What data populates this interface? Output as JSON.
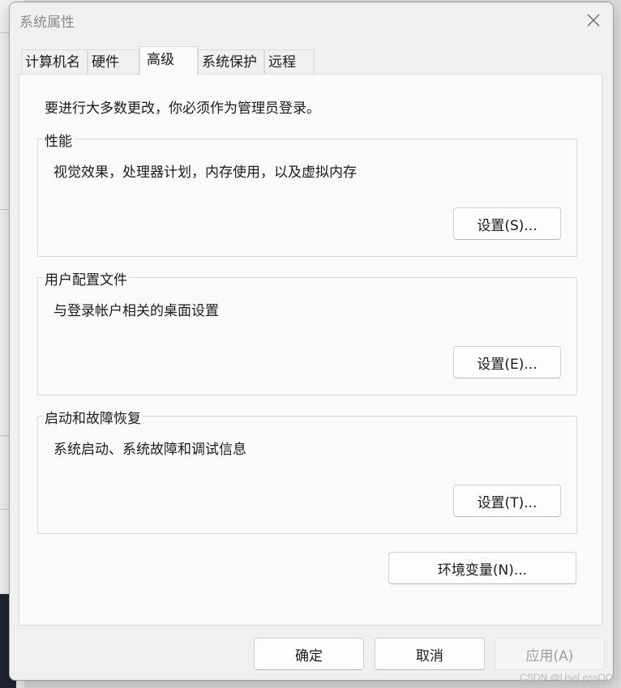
{
  "window": {
    "title": "系统属性"
  },
  "tabs": [
    {
      "label": "计算机名",
      "active": false
    },
    {
      "label": "硬件",
      "active": false
    },
    {
      "label": "高级",
      "active": true
    },
    {
      "label": "系统保护",
      "active": false
    },
    {
      "label": "远程",
      "active": false
    }
  ],
  "intro": "要进行大多数更改，你必须作为管理员登录。",
  "groups": [
    {
      "title": "性能",
      "description": "视觉效果，处理器计划，内存使用，以及虚拟内存",
      "button": "设置(S)..."
    },
    {
      "title": "用户配置文件",
      "description": "与登录帐户相关的桌面设置",
      "button": "设置(E)..."
    },
    {
      "title": "启动和故障恢复",
      "description": "系统启动、系统故障和调试信息",
      "button": "设置(T)..."
    }
  ],
  "env_button": "环境变量(N)...",
  "footer": {
    "ok": "确定",
    "cancel": "取消",
    "apply": "应用(A)",
    "apply_disabled": true
  },
  "watermark": "CSDN @UseLessQQ",
  "icons": {
    "close": "close-icon"
  }
}
